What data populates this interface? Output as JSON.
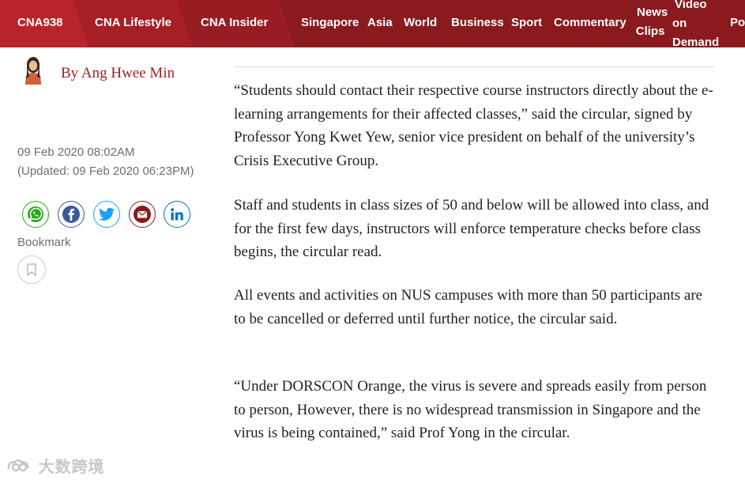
{
  "nav": {
    "brand_tabs": [
      "CNA938",
      "CNA Lifestyle",
      "CNA Insider"
    ],
    "sections": [
      "Singapore",
      "Asia",
      "World",
      "Business",
      "Sport",
      "Commentary"
    ],
    "news_clips": [
      "News",
      "Clips"
    ],
    "video_on_demand": [
      "Video",
      "on",
      "Demand"
    ],
    "overflow": "Po"
  },
  "author": {
    "byline": "By Ang Hwee Min",
    "avatar_icon": "author-photo"
  },
  "dates": {
    "published": "09 Feb 2020 08:02AM",
    "updated": "(Updated: 09 Feb 2020 06:23PM)"
  },
  "share": {
    "icons": [
      "whatsapp-icon",
      "facebook-icon",
      "twitter-icon",
      "email-icon",
      "linkedin-icon"
    ],
    "colors": {
      "whatsapp": "#2aa81a",
      "facebook": "#3b5998",
      "twitter": "#1da1f2",
      "email": "#8b1a1a",
      "linkedin": "#0077b5"
    }
  },
  "bookmark": {
    "label": "Bookmark"
  },
  "article": {
    "paragraphs": [
      "“Students should contact their respective course instructors directly about the e-learning arrangements for their affected classes,” said the circular, signed by Professor Yong Kwet Yew, senior vice president on behalf of the university’s Crisis Executive Group.",
      "Staff and students in class sizes of 50 and below will be allowed into class, and for the first few days, instructors will enforce temperature checks before class begins, the circular read.",
      "All events and activities on NUS campuses with more than 50 participants are to be cancelled or deferred until further notice, the circular said.",
      "“Under DORSCON Orange, the virus is severe and spreads easily from person to person, However, there is no widespread transmission in Singapore and the virus is being contained,” said Prof Yong in the circular."
    ]
  },
  "watermark": {
    "text": "大数跨境"
  },
  "colors": {
    "nav_bg": "#8a1a1e",
    "accent": "#9b2226"
  }
}
